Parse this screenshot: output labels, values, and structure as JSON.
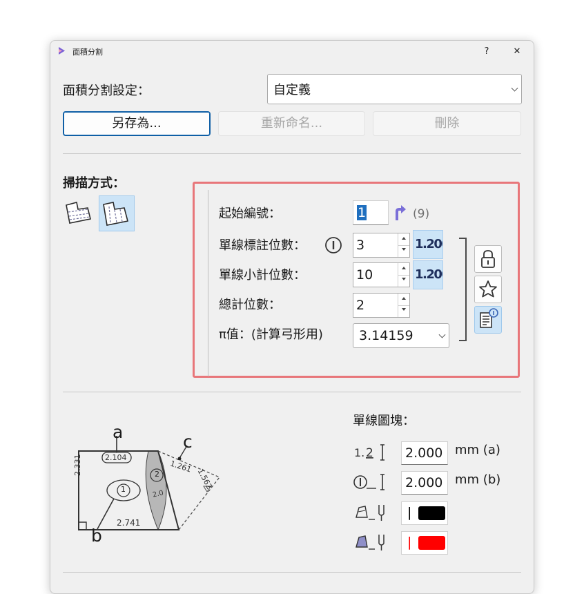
{
  "window": {
    "title": "面積分割",
    "help_label": "?",
    "close_label": "✕"
  },
  "preset": {
    "label": "面積分割設定：",
    "value": "自定義"
  },
  "actions": {
    "save_as": "另存為...",
    "rename": "重新命名...",
    "delete": "刪除"
  },
  "scan": {
    "label": "掃描方式：",
    "icons": [
      "scan-mode-1-icon",
      "scan-mode-2-icon"
    ],
    "selected_index": 1
  },
  "numbering": {
    "start_label": "起始編號：",
    "start_value": "1",
    "next_hint": "(9)",
    "single_dim_label": "單線標註位數：",
    "single_dim_value": "3",
    "single_sub_label": "單線小計位數：",
    "single_sub_value": "10",
    "total_label": "總計位數：",
    "total_value": "2",
    "pi_label": "π值：(計算弓形用)",
    "pi_value": "3.14159",
    "format_preview": "1.200"
  },
  "diagram": {
    "label_a": "a",
    "label_b": "b",
    "label_c": "c",
    "dim_top": "2.104",
    "dim_left": "2.331",
    "dim_bottom": "2.741",
    "dim_arc_1": "1.261",
    "dim_arc_2": "1.562",
    "circle_1": "1",
    "circle_2": "2",
    "arc_inner": "2.0"
  },
  "block": {
    "label": "單線圖塊：",
    "size_a_value": "2.000",
    "size_a_unit": "mm (a)",
    "size_b_value": "2.000",
    "size_b_unit": "mm (b)",
    "color_1": "#000000",
    "color_2": "#ff0000",
    "row_icon_1": "dimension-number-icon",
    "row_icon_2": "circled-number-icon",
    "row_icon_3": "text-layer-pen-icon",
    "row_icon_4": "fill-layer-pen-icon",
    "color_mark": "|"
  },
  "colors": {
    "highlight": "#e8767a",
    "selected": "#cce4f7",
    "accent": "#0f5fa6",
    "arrow": "#7a6fd8"
  }
}
